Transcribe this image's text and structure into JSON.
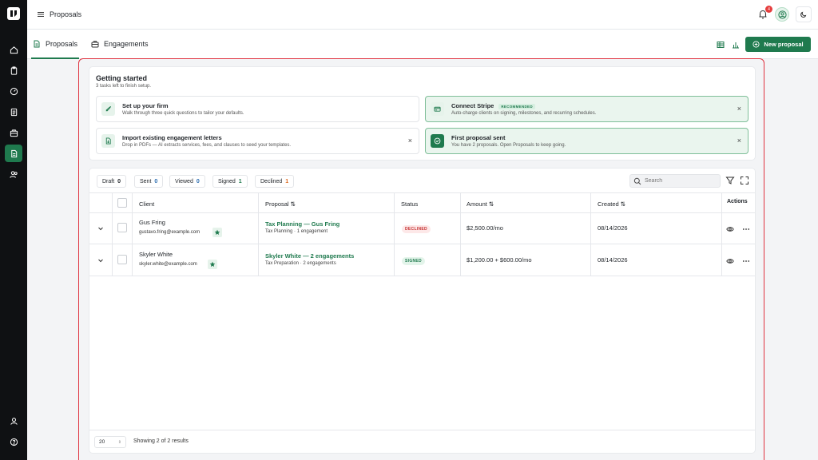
{
  "topbar": {
    "title": "Proposals",
    "notification_count": "4"
  },
  "tabs": [
    {
      "label": "Proposals",
      "active": true
    },
    {
      "label": "Engagements",
      "active": false
    }
  ],
  "new_proposal_label": "New proposal",
  "getting_started": {
    "title": "Getting started",
    "subtitle": "3 tasks left to finish setup.",
    "tasks": [
      {
        "title": "Set up your firm",
        "desc": "Walk through three quick questions to tailor your defaults.",
        "icon": "rocket-icon",
        "dismissable": false
      },
      {
        "title": "Connect Stripe",
        "badge": "RECOMMENDED",
        "desc": "Auto-charge clients on signing, milestones, and recurring schedules.",
        "icon": "card-icon",
        "dismissable": true
      },
      {
        "title": "Import existing engagement letters",
        "desc": "Drop in PDFs — AI extracts services, fees, and clauses to seed your templates.",
        "icon": "file-import-icon",
        "dismissable": true
      },
      {
        "title": "First proposal sent",
        "desc": "You have 2 proposals. Open Proposals to keep going.",
        "icon": "check-circle-icon",
        "dismissable": true
      }
    ]
  },
  "filters": [
    {
      "label": "Draft",
      "count": "0",
      "color": "#1f2328"
    },
    {
      "label": "Sent",
      "count": "0",
      "color": "#2b6cb0"
    },
    {
      "label": "Viewed",
      "count": "0",
      "color": "#2b6cb0"
    },
    {
      "label": "Signed",
      "count": "1",
      "color": "#1f7a4e"
    },
    {
      "label": "Declined",
      "count": "1",
      "color": "#dd6b20"
    }
  ],
  "search_placeholder": "Search",
  "columns": {
    "client": "Client",
    "proposal": "Proposal ⇅",
    "status": "Status",
    "amount": "Amount ⇅",
    "created": "Created ⇅",
    "actions": "Actions"
  },
  "rows": [
    {
      "client_name": "Gus Fring",
      "client_email": "gustavo.fring@example.com",
      "proposal_title": "Tax Planning — Gus Fring",
      "proposal_sub": "Tax Planning · 1 engagement",
      "status": "DECLINED",
      "amount": "$2,500.00/mo",
      "created": "08/14/2026"
    },
    {
      "client_name": "Skyler White",
      "client_email": "skyler.white@example.com",
      "proposal_title": "Skyler White — 2 engagements",
      "proposal_sub": "Tax Preparation · 2 engagements",
      "status": "SIGNED",
      "amount": "$1,200.00 + $600.00/mo",
      "created": "08/14/2026"
    }
  ],
  "footer": {
    "page_size": "20",
    "showing": "Showing 2 of 2 results"
  },
  "colors": {
    "accent": "#1f7a4e",
    "rail": "#0f1113",
    "highlight": "#e0323f"
  }
}
